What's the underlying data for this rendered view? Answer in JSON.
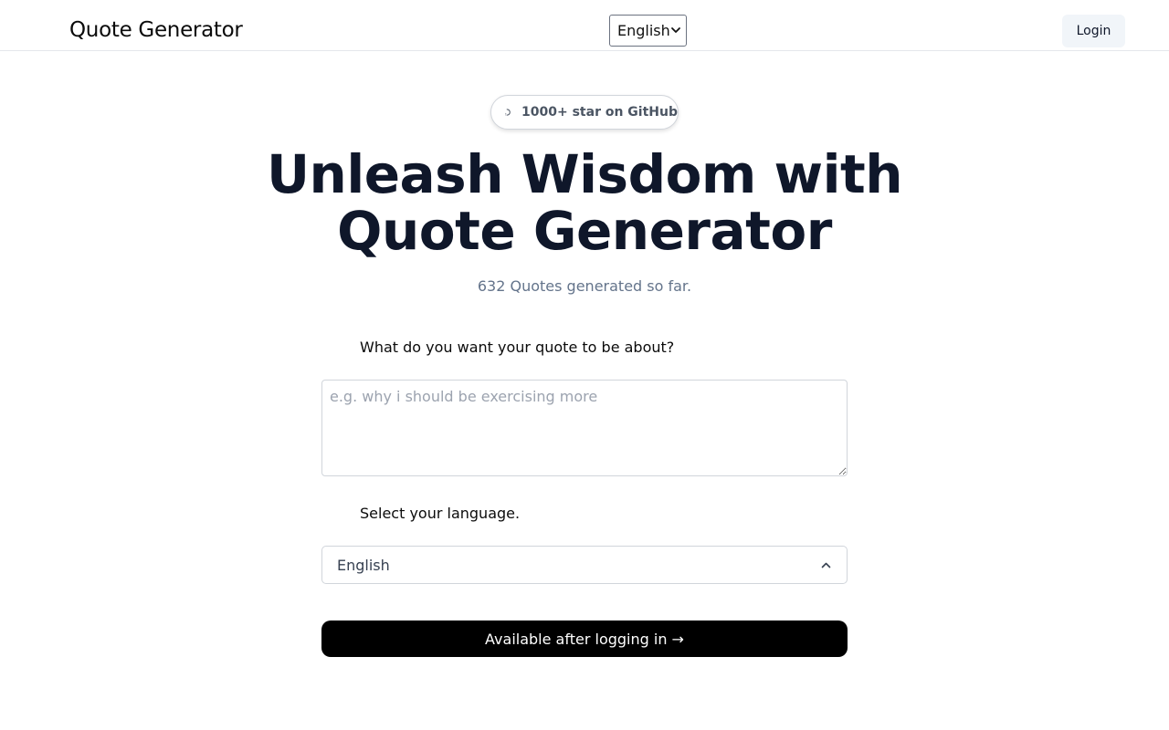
{
  "header": {
    "brand": "Quote Generator",
    "language_selected": "English",
    "login_label": "Login"
  },
  "badge": {
    "text": "1000+ star on GitHub",
    "icon": "github-icon"
  },
  "hero": {
    "title_line1": "Unleash Wisdom with",
    "title_line2": "Quote Generator",
    "counter": "632 Quotes generated so far."
  },
  "form": {
    "topic_label": "What do you want your quote to be about?",
    "topic_placeholder": "e.g. why i should be exercising more",
    "topic_value": "",
    "language_label": "Select your language.",
    "language_value": "English",
    "submit_label": "Available after logging in →"
  },
  "colors": {
    "submit_bg": "#000000",
    "login_bg": "#f1f5f9",
    "title": "#0f172a",
    "muted": "#64748b"
  }
}
